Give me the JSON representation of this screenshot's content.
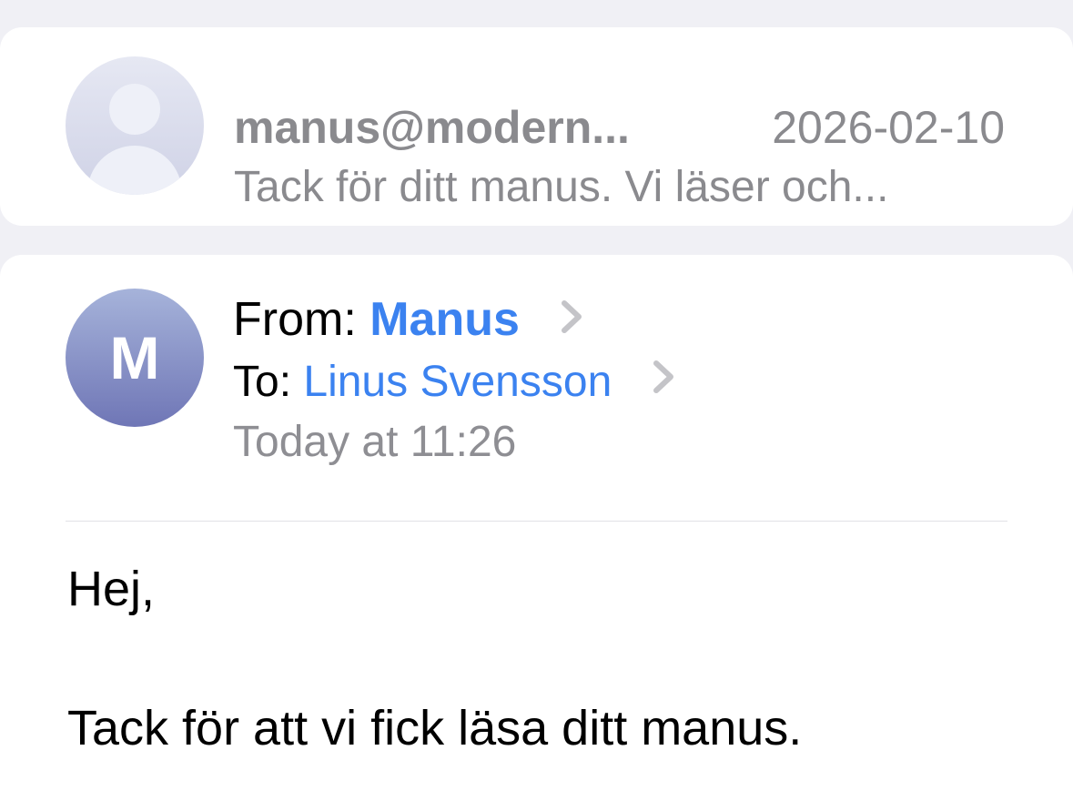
{
  "previous_message": {
    "sender": "manus@modern...",
    "date": "2026-02-10",
    "snippet": "Tack för ditt manus. Vi läser och..."
  },
  "message": {
    "avatar_letter": "M",
    "from_label": "From:",
    "from_name": "Manus",
    "to_label": "To:",
    "to_name": "Linus Svensson",
    "time": "Today at 11:26",
    "body": {
      "greeting": "Hej,",
      "line1": "Tack för att vi fick läsa ditt manus."
    }
  },
  "colors": {
    "background": "#f0f0f5",
    "link_blue": "#3b82f0",
    "secondary_gray": "#8a8a8e"
  },
  "icons": [
    "placeholder-avatar-icon",
    "chevron-right-icon"
  ]
}
